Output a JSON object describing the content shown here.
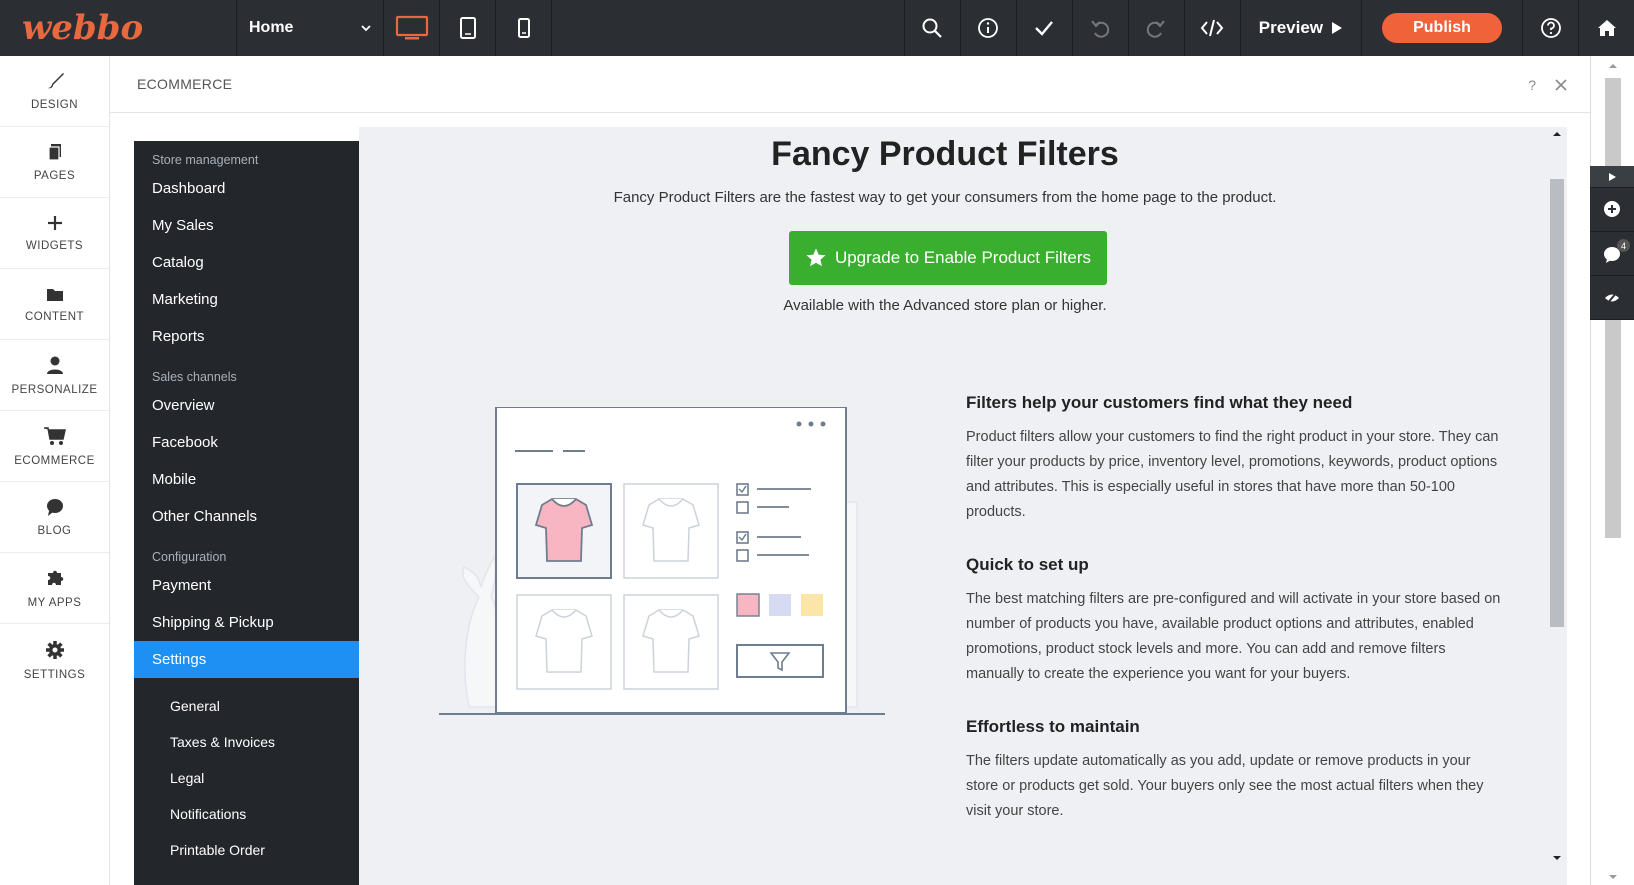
{
  "topbar": {
    "logo": "webbo",
    "page_select": "Home",
    "preview_label": "Preview",
    "publish_label": "Publish",
    "devices": [
      "desktop-icon",
      "tablet-icon",
      "mobile-icon"
    ],
    "tools": [
      "search-icon",
      "info-icon",
      "check-icon",
      "undo-icon",
      "redo-icon",
      "code-icon"
    ],
    "accent": "#e8683f",
    "publish_color": "#f0633a"
  },
  "rail": {
    "items": [
      {
        "label": "DESIGN",
        "icon": "brush-icon"
      },
      {
        "label": "PAGES",
        "icon": "pages-icon"
      },
      {
        "label": "WIDGETS",
        "icon": "plus-icon"
      },
      {
        "label": "CONTENT",
        "icon": "folder-icon"
      },
      {
        "label": "PERSONALIZE",
        "icon": "person-icon"
      },
      {
        "label": "ECOMMERCE",
        "icon": "cart-icon"
      },
      {
        "label": "BLOG",
        "icon": "chat-bubble-icon"
      },
      {
        "label": "MY APPS",
        "icon": "puzzle-icon"
      },
      {
        "label": "SETTINGS",
        "icon": "gear-icon"
      }
    ]
  },
  "panel": {
    "title": "ECOMMERCE",
    "help": "?"
  },
  "nav": {
    "sections": [
      {
        "caption": "Store management",
        "items": [
          "Dashboard",
          "My Sales",
          "Catalog",
          "Marketing",
          "Reports"
        ]
      },
      {
        "caption": "Sales channels",
        "items": [
          "Overview",
          "Facebook",
          "Mobile",
          "Other Channels"
        ]
      },
      {
        "caption": "Configuration",
        "items": [
          "Payment",
          "Shipping & Pickup",
          "Settings"
        ]
      }
    ],
    "active": "Settings",
    "sub_items": [
      "General",
      "Taxes & Invoices",
      "Legal",
      "Notifications",
      "Printable Order"
    ],
    "active_color": "#1e8ff3"
  },
  "content": {
    "title": "Fancy Product Filters",
    "subtitle": "Fancy Product Filters are the fastest way to get your consumers from the home page to the product.",
    "upgrade_label": "Upgrade to Enable Product Filters",
    "note": "Available with the Advanced store plan or higher.",
    "features": [
      {
        "heading": "Filters help your customers find what they need",
        "text": "Product filters allow your customers to find the right product in your store. They can filter your products by price, inventory level, promotions, keywords, product options and attributes. This is especially useful in stores that have more than 50-100 products."
      },
      {
        "heading": "Quick to set up",
        "text": "The best matching filters are pre-configured and will activate in your store based on number of products you have, available product options and attributes, enabled promotions, product stock levels and more. You can add and remove filters manually to create the experience you want for your buyers."
      },
      {
        "heading": "Effortless to maintain",
        "text": "The filters update automatically as you add, update or remove products in your store or products get sold. Your buyers only see the most actual filters when they visit your store."
      }
    ],
    "upgrade_color": "#3aae2e"
  },
  "side_tools": {
    "badge": "4"
  }
}
